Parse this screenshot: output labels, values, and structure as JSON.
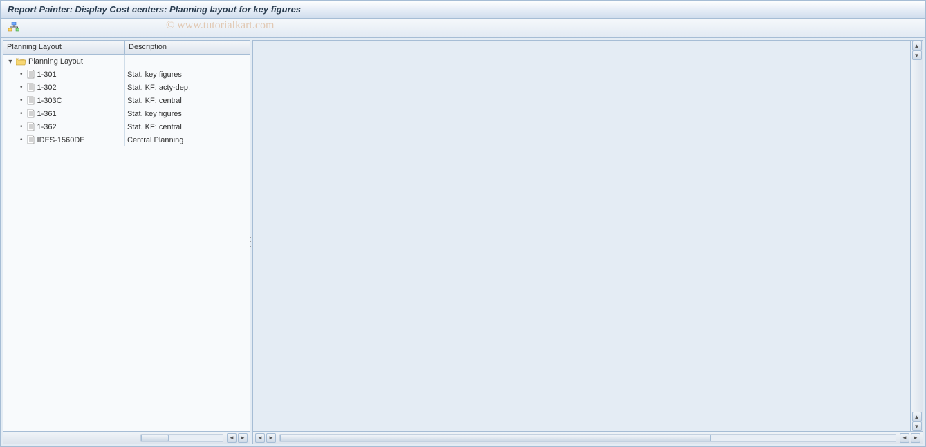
{
  "title": "Report Painter: Display Cost centers: Planning layout for key figures",
  "watermark": "© www.tutorialkart.com",
  "tree": {
    "headers": {
      "col1": "Planning Layout",
      "col2": "Description"
    },
    "root": {
      "label": "Planning Layout",
      "expanded": true
    },
    "items": [
      {
        "id": "1-301",
        "desc": "Stat. key figures"
      },
      {
        "id": "1-302",
        "desc": "Stat. KF: acty-dep."
      },
      {
        "id": "1-303C",
        "desc": "Stat. KF: central"
      },
      {
        "id": "1-361",
        "desc": "Stat. key figures"
      },
      {
        "id": "1-362",
        "desc": "Stat. KF: central"
      },
      {
        "id": "IDES-1560DE",
        "desc": "Central Planning"
      }
    ]
  }
}
